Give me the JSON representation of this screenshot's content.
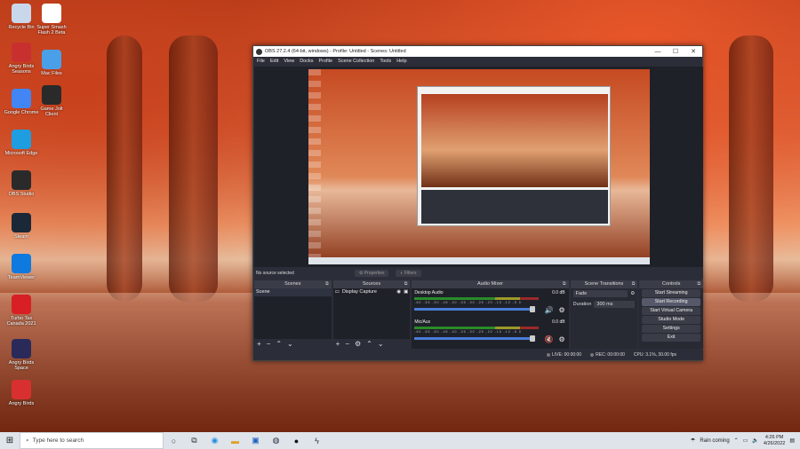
{
  "desktop": {
    "icons": [
      {
        "label": "Recycle Bin",
        "icon": "recycle-bin-icon",
        "color": "#c8d8ea"
      },
      {
        "label": "Super Smash Flash 2 Beta",
        "icon": "ssf2-icon",
        "color": "#ffffff"
      },
      {
        "label": "Angry Birds Seasons",
        "icon": "angry-birds-seasons-icon",
        "color": "#c83030"
      },
      {
        "label": "Mac Files",
        "icon": "folder-icon",
        "color": "#4aa0e8"
      },
      {
        "label": "Google Chrome",
        "icon": "chrome-icon",
        "color": "#4285f4"
      },
      {
        "label": "Game Jolt Client",
        "icon": "game-jolt-icon",
        "color": "#2a2a2a"
      },
      {
        "label": "Microsoft Edge",
        "icon": "edge-icon",
        "color": "#1e9de0"
      },
      {
        "label": "OBS Studio",
        "icon": "obs-icon",
        "color": "#2a2a2a"
      },
      {
        "label": "Steam",
        "icon": "steam-icon",
        "color": "#1b2838"
      },
      {
        "label": "TeamViewer",
        "icon": "teamviewer-icon",
        "color": "#0e7ae0"
      },
      {
        "label": "Turbo Tax Canada 2021",
        "icon": "turbotax-icon",
        "color": "#d81f26"
      },
      {
        "label": "Angry Birds Space",
        "icon": "angry-birds-space-icon",
        "color": "#2a2a5a"
      },
      {
        "label": "Angry Birds",
        "icon": "angry-birds-icon",
        "color": "#d83030"
      }
    ]
  },
  "obs": {
    "title": "OBS 27.2.4 (64-bit, windows) - Profile: Untitled - Scenes: Untitled",
    "window_controls": {
      "minimize": "—",
      "maximize": "☐",
      "close": "✕"
    },
    "menu": [
      "File",
      "Edit",
      "View",
      "Docks",
      "Profile",
      "Scene Collection",
      "Tools",
      "Help"
    ],
    "source_toolbar": {
      "status": "No source selected",
      "properties": "Properties",
      "filters": "Filters"
    },
    "scenes": {
      "header": "Scenes",
      "items": [
        "Scene"
      ]
    },
    "sources": {
      "header": "Sources",
      "items": [
        "Display Capture"
      ]
    },
    "mixer": {
      "header": "Audio Mixer",
      "channels": [
        {
          "name": "Desktop Audio",
          "db": "0.0 dB",
          "muted": false
        },
        {
          "name": "Mic/Aux",
          "db": "0.0 dB",
          "muted": true
        }
      ],
      "ticks": "-60 -55 -50 -45 -40 -35 -30 -25 -20 -15 -10 -5 0"
    },
    "transitions": {
      "header": "Scene Transitions",
      "selected": "Fade",
      "duration_label": "Duration",
      "duration": "300 ms"
    },
    "controls": {
      "header": "Controls",
      "buttons": [
        "Start Streaming",
        "Start Recording",
        "Start Virtual Camera",
        "Studio Mode",
        "Settings",
        "Exit"
      ]
    },
    "statusbar": {
      "live": "LIVE: 00:00:00",
      "rec": "REC: 00:00:00",
      "cpu": "CPU: 3.1%, 30.00 fps"
    }
  },
  "taskbar": {
    "search_placeholder": "Type here to search",
    "weather": "Rain coming",
    "time": "4:26 PM",
    "date": "4/26/2022"
  }
}
